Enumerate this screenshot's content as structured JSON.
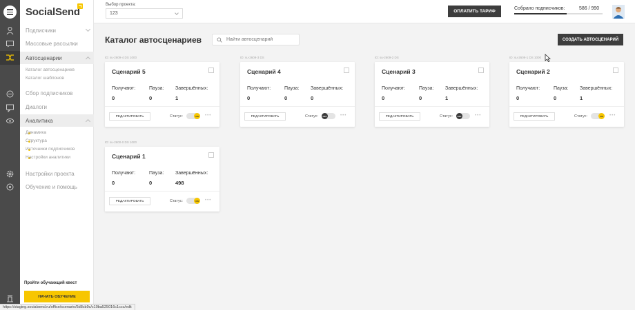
{
  "app": {
    "brand": "SocialSend",
    "accent_color": "#f7c600",
    "dark_color": "#3d3d3d"
  },
  "rail": {
    "icons": [
      "menu-icon",
      "subscribers-icon",
      "broadcast-icon",
      "autoscenarios-icon",
      "collect-icon",
      "dialogs-icon",
      "analytics-icon",
      "settings-icon",
      "help-icon",
      "quest-icon"
    ]
  },
  "sidebar": {
    "items": [
      {
        "label": "Подписчики"
      },
      {
        "label": "Массовые рассылки"
      },
      {
        "label": "Автосценарии"
      },
      {
        "label": "Сбор подписчиков"
      },
      {
        "label": "Диалоги"
      },
      {
        "label": "Аналитика"
      },
      {
        "label": "Настройки проекта"
      },
      {
        "label": "Обучение и помощь"
      }
    ],
    "autoscenario_sub": [
      "Каталог автосценариев",
      "Каталог шаблонов"
    ],
    "analytics_sub": [
      "Динамика",
      "Структура",
      "Источники подписчиков",
      "Настройки аналитики"
    ],
    "quest_label": "Пройти обучающий квест",
    "quest_button": "НАЧАТЬ ОБУЧЕНИЕ"
  },
  "topbar": {
    "project_label": "Выбор проекта:",
    "project_value": "123",
    "pay_button": "ОПЛАТИТЬ ТАРИФ",
    "subscribers_label": "Собрано подписчиков:",
    "subscribers_count": "586 / 990",
    "subscribers_progress": 0.59
  },
  "main": {
    "title": "Каталог автосценариев",
    "search_placeholder": "Найти автосценарий",
    "create_button": "СОЗДАТЬ АВТОСЦЕНАРИЙ"
  },
  "cards": [
    {
      "id": "ID: su-2609-4 DS 1000",
      "title": "Сценарий 5",
      "received_label": "Получают:",
      "received": "0",
      "pause_label": "Пауза:",
      "pause": "0",
      "done_label": "Завершённых:",
      "done": "1",
      "edit": "РЕДАКТИРОВАТЬ",
      "status_label": "Статус:",
      "status": "ON"
    },
    {
      "id": "ID: su-2609-3 DS",
      "title": "Сценарий 4",
      "received_label": "Получают:",
      "received": "0",
      "pause_label": "Пауза:",
      "pause": "0",
      "done_label": "Завершённых:",
      "done": "0",
      "edit": "РЕДАКТИРОВАТЬ",
      "status_label": "Статус:",
      "status": "OFF"
    },
    {
      "id": "ID: su-2609-2 DS",
      "title": "Сценарий 3",
      "received_label": "Получают:",
      "received": "0",
      "pause_label": "Пауза:",
      "pause": "0",
      "done_label": "Завершённых:",
      "done": "1",
      "edit": "РЕДАКТИРОВАТЬ",
      "status_label": "Статус:",
      "status": "OFF"
    },
    {
      "id": "ID: su-2609-1 DS 1000",
      "title": "Сценарий 2",
      "received_label": "Получают:",
      "received": "0",
      "pause_label": "Пауза:",
      "pause": "0",
      "done_label": "Завершённых:",
      "done": "1",
      "edit": "РЕДАКТИРОВАТЬ",
      "status_label": "Статус:",
      "status": "ON"
    },
    {
      "id": "ID: su-2600-0 DS 1000",
      "title": "Сценарий 1",
      "received_label": "Получают:",
      "received": "0",
      "pause_label": "Пауза:",
      "pause": "0",
      "done_label": "Завершённых:",
      "done": "498",
      "edit": "РЕДАКТИРОВАТЬ",
      "status_label": "Статус:",
      "status": "ON"
    }
  ],
  "statusbar": {
    "url": "https://staging.socialsend.ru/office/scenario/5d8cb9c/c10ba525016c1ccc/edit"
  }
}
